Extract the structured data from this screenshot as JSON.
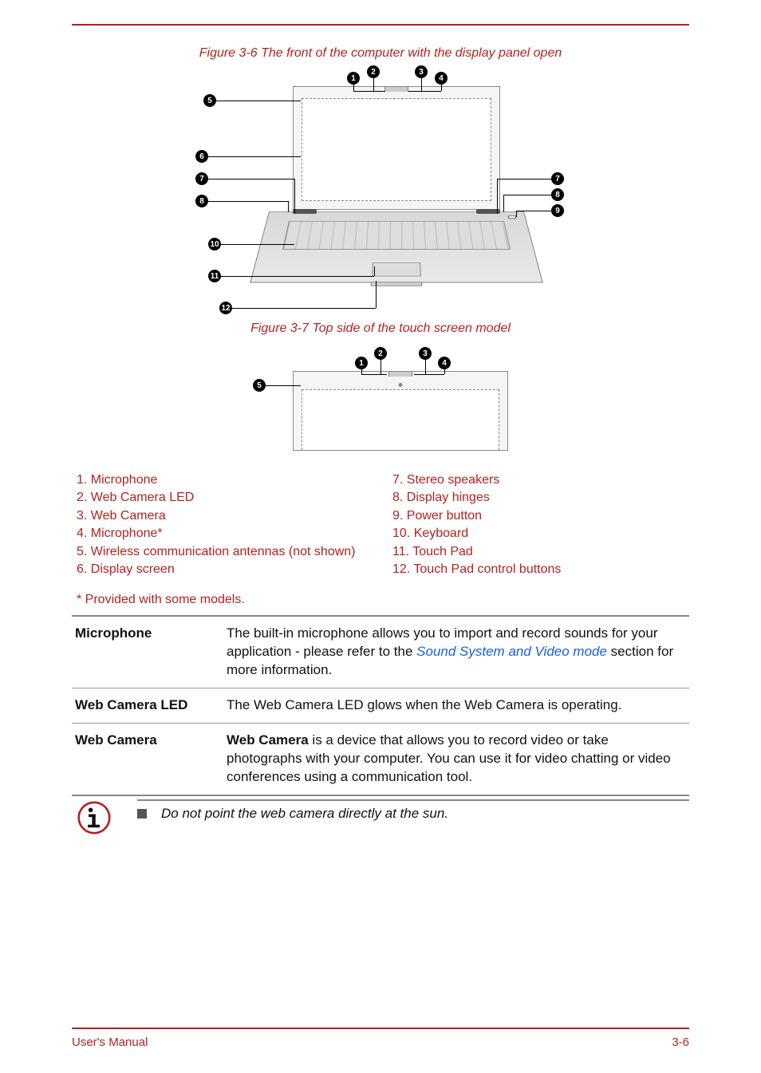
{
  "figure1_caption": "Figure 3-6 The front of the computer with the display panel open",
  "figure2_caption": "Figure 3-7 Top side of the touch screen model",
  "callouts_fig1": [
    "1",
    "2",
    "3",
    "4",
    "5",
    "6",
    "7",
    "7",
    "8",
    "8",
    "9",
    "10",
    "11",
    "12"
  ],
  "callouts_fig2": [
    "1",
    "2",
    "3",
    "4",
    "5"
  ],
  "legend": {
    "left": [
      "1. Microphone",
      "2. Web Camera LED",
      "3. Web Camera",
      "4. Microphone*",
      "5. Wireless communication antennas (not shown)",
      "6. Display screen"
    ],
    "right": [
      "7. Stereo speakers",
      "8. Display hinges",
      "9. Power button",
      "10. Keyboard",
      "11. Touch Pad",
      "",
      "12. Touch Pad control buttons"
    ]
  },
  "note_models": "* Provided with some models.",
  "table": {
    "rows": [
      {
        "term": "Microphone",
        "text_before": "The built-in microphone allows you to import and record sounds for your application - please refer to the ",
        "link": "Sound System and Video mode",
        "text_after": " section for more information."
      },
      {
        "term": "Web Camera LED",
        "text": "The Web Camera LED glows when the Web Camera is operating."
      },
      {
        "term": "Web Camera",
        "bold_lead": "Web Camera",
        "text": " is a device that allows you to record video or take photographs with your computer. You can use it for video chatting or video conferences using a communication tool."
      }
    ]
  },
  "info_note": "Do not point the web camera directly at the sun.",
  "footer": {
    "left": "User's Manual",
    "right": "3-6"
  }
}
